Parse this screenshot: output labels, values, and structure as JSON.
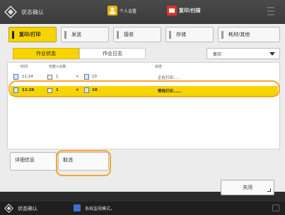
{
  "topbar": {
    "status_label": "状态确认",
    "shortcut1_label": "个人设置",
    "shortcut2_label": "复印/扫描"
  },
  "tabs": [
    {
      "label": "复印/打印",
      "active": true
    },
    {
      "label": "发送",
      "active": false
    },
    {
      "label": "接收",
      "active": false
    },
    {
      "label": "存储",
      "active": false
    },
    {
      "label": "耗材/其他",
      "active": false
    }
  ],
  "subtabs": {
    "job_status": "作业状态",
    "job_log": "作业日志"
  },
  "filter": {
    "selected": "复印"
  },
  "list": {
    "headers": {
      "time": "时间",
      "copies": "份数×合数",
      "status": "状态"
    },
    "rows": [
      {
        "time": "11:24",
        "copies": "1",
        "sets": "10",
        "status": "正在打印……"
      },
      {
        "time": "11:26",
        "copies": "1",
        "sets": "10",
        "status": "等待打印……"
      }
    ]
  },
  "buttons": {
    "details": "详细信息",
    "cancel": "取消",
    "close": "关闭"
  },
  "footer": {
    "status_label": "状态确认",
    "message": "系统监视模式。"
  },
  "colors": {
    "accent": "#f6d400",
    "callout": "#f4a52c"
  }
}
